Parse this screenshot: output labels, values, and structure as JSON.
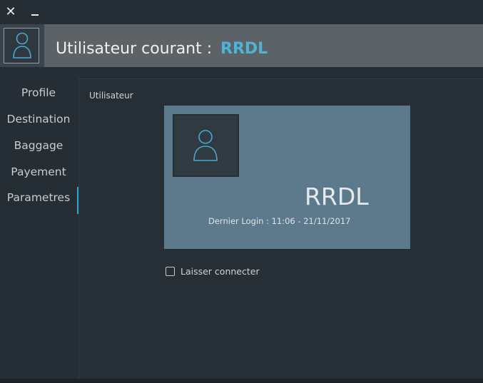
{
  "window": {
    "close_symbol": "✕",
    "minimize_icon": "minimize-icon"
  },
  "header": {
    "title_label": "Utilisateur courant :",
    "current_user": "RRDL",
    "avatar_icon": "user-icon"
  },
  "sidebar": {
    "items": [
      {
        "label": "Profile"
      },
      {
        "label": "Destination"
      },
      {
        "label": "Baggage"
      },
      {
        "label": "Payement"
      },
      {
        "label": "Parametres"
      }
    ],
    "active_index": 4
  },
  "main": {
    "section_title": "Utilisateur",
    "card": {
      "avatar_icon": "user-icon",
      "username": "RRDL",
      "last_login": "Dernier Login : 11:06 - 21/11/2017"
    },
    "stay_connected": {
      "label": "Laisser connecter",
      "checked": false
    }
  },
  "colors": {
    "accent": "#4fb3d6",
    "active_indicator": "#2aa7d4",
    "background": "#252e34",
    "header": "#5d6266",
    "card": "#5c7a8c"
  }
}
